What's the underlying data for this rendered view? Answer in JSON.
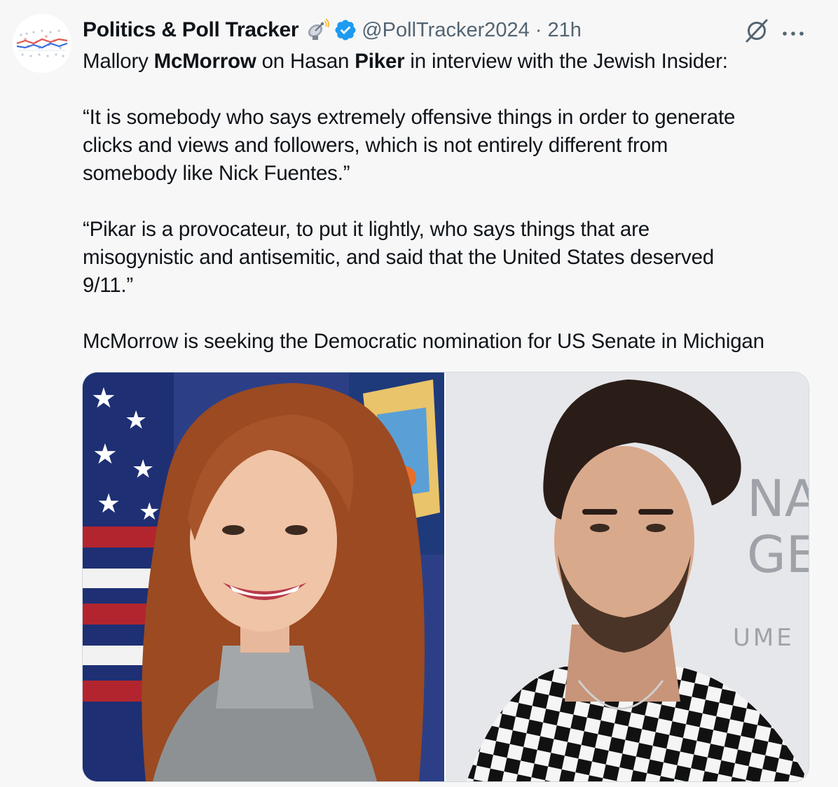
{
  "author": {
    "display_name": "Politics & Poll Tracker",
    "handle": "@PollTracker2024",
    "separator": "·",
    "time_ago": "21h",
    "avatar_icon": "line-chart-avatar",
    "badge_icon": "satellite-dish-emoji",
    "verified_icon": "verified-badge-icon"
  },
  "actions": {
    "grok_icon": "grok-icon",
    "more_icon": "more-options-icon"
  },
  "tweet": {
    "line1": {
      "t1": "Mallory ",
      "b1": "McMorrow",
      "t2": " on Hasan ",
      "b2": "Piker",
      "t3": " in interview with the Jewish Insider:"
    },
    "quote1": [
      "“It is somebody who says extremely offensive things in order to generate",
      "clicks and views and followers, which is not entirely different from",
      "somebody like Nick Fuentes.”"
    ],
    "quote2": [
      "“Pikar is a provocateur, to put it lightly, who says things that are",
      "misogynistic and antisemitic, and said that the United States deserved",
      "9/11.”"
    ],
    "closing": "McMorrow is seeking the Democratic nomination for US Senate in Michigan"
  },
  "media": {
    "left_photo": "woman-portrait-photo",
    "right_photo": "man-portrait-photo",
    "backdrop_text": [
      "NA",
      "GE",
      "UME"
    ]
  },
  "colors": {
    "verified": "#1d9bf0",
    "secondary_text": "#536471",
    "background": "#f7f7f8"
  }
}
